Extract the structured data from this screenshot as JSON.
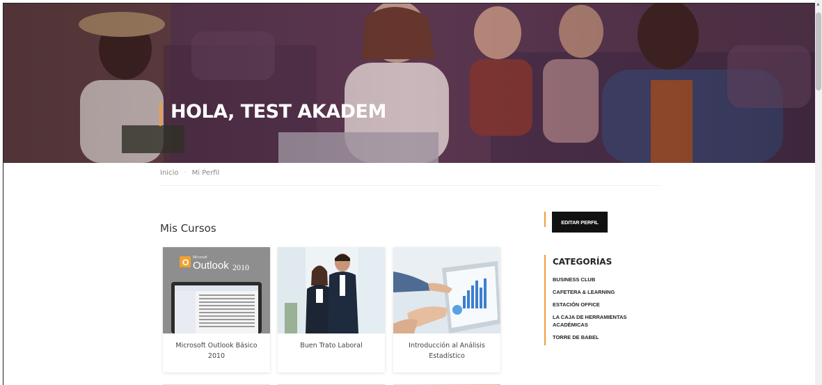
{
  "hero": {
    "greeting": "HOLA, TEST AKADEM"
  },
  "breadcrumb": {
    "home": "Inicio",
    "separator": "·",
    "current": "Mi Perfil"
  },
  "courses": {
    "section_title": "Mis Cursos",
    "items": [
      {
        "title": "Microsoft Outlook Básico 2010",
        "thumb_brand": "Microsoft",
        "thumb_product": "Outlook",
        "thumb_version": "2010"
      },
      {
        "title": "Buen Trato Laboral"
      },
      {
        "title": "Introducción al Análisis Estadístico"
      }
    ]
  },
  "sidebar": {
    "edit_profile_label": "EDITAR PERFIL",
    "categories_title": "CATEGORÍAS",
    "categories": [
      "BUSINESS CLUB",
      "CAFETERA & LEARNING",
      "ESTACIÓN OFFICE",
      "LA CAJA DE HERRAMIENTAS ACADÉMICAS",
      "TORRE DE BABEL"
    ]
  },
  "colors": {
    "accent": "#f39c3c",
    "button_bg": "#111111"
  },
  "icons": {
    "scroll_up": "chevron-up-icon"
  }
}
